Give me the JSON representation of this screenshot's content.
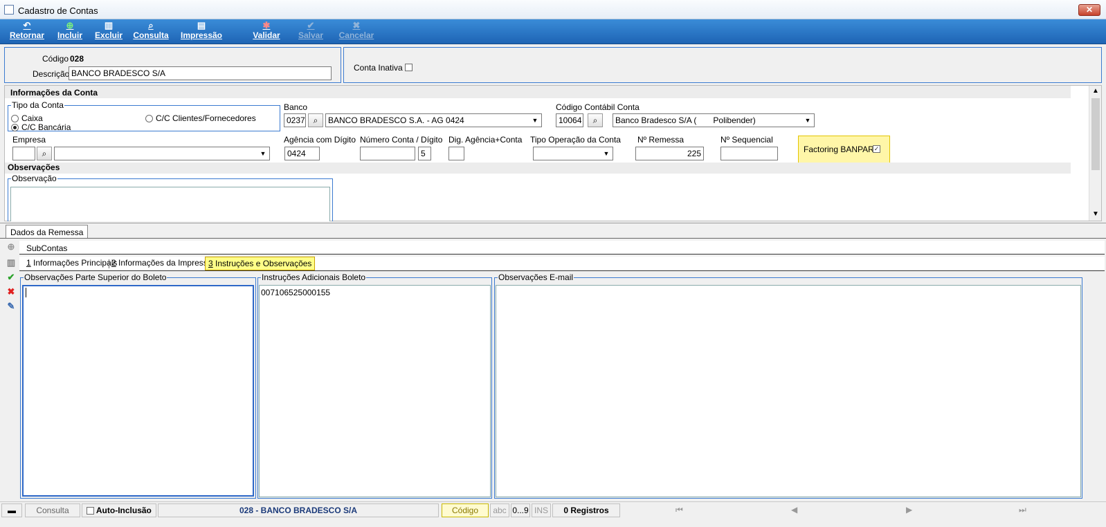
{
  "window": {
    "title": "Cadastro de Contas",
    "close_label": "✕"
  },
  "toolbar": {
    "retornar": "Retornar",
    "incluir": "Incluir",
    "excluir": "Excluir",
    "consulta": "Consulta",
    "impressao": "Impressão",
    "validar": "Validar",
    "salvar": "Salvar",
    "cancelar": "Cancelar"
  },
  "header": {
    "codigo_label": "Código",
    "codigo_value": "028",
    "descricao_label": "Descrição",
    "descricao_value": "BANCO BRADESCO S/A ",
    "conta_inativa_label": "Conta Inativa"
  },
  "info": {
    "section_title": "Informações da Conta",
    "tipo_conta_title": "Tipo da Conta",
    "opt_caixa": "Caixa",
    "opt_cc_bancaria": "C/C Bancária",
    "opt_cc_clientes": "C/C Clientes/Fornecedores",
    "banco_label": "Banco",
    "banco_code": "0237",
    "banco_name": "BANCO BRADESCO S.A. - AG 0424",
    "cod_contabil_label": "Código Contábil Conta",
    "cod_contabil_code": "10064",
    "cod_contabil_name": "Banco Bradesco S/A (",
    "cod_contabil_name_suffix": "Polibender)",
    "empresa_label": "Empresa",
    "empresa_code": "",
    "empresa_name": "",
    "agencia_label": "Agência com Dígito",
    "agencia_value": "0424",
    "numero_conta_label": "Número Conta / Dígito",
    "numero_conta_value": "",
    "numero_conta_digito": "5",
    "dig_agencia_label": "Dig. Agência+Conta",
    "dig_agencia_value": "",
    "tipo_operacao_label": "Tipo Operação da Conta",
    "tipo_operacao_value": "",
    "n_remessa_label": "Nº Remessa",
    "n_remessa_value": "225",
    "n_sequencial_label": "Nº Sequencial",
    "n_sequencial_value": "",
    "factoring_label": "Factoring BANPAR",
    "observacoes_section": "Observações",
    "observacao_title": "Observação"
  },
  "tabs": {
    "dados_remessa": "Dados da Remessa",
    "subcontas": "SubContas",
    "sub1_num": "1",
    "sub1": " Informações Principais",
    "sub2_num": "2",
    "sub2": " Informações da Impressão",
    "sub3_num": "3",
    "sub3": " Instruções e Observações"
  },
  "boleto": {
    "obs_superior_title": "Observações Parte Superior do Boleto",
    "obs_superior_value": "",
    "instrucoes_title": "Instruções Adicionais Boleto",
    "instrucoes_value": "007106525000155",
    "obs_email_title": "Observações E-mail",
    "obs_email_value": ""
  },
  "statusbar": {
    "consulta": "Consulta",
    "auto_inclusao": "Auto-Inclusão",
    "record": "028 - BANCO BRADESCO S/A ",
    "codigo": "Código",
    "abc": "abc",
    "range": "0...9",
    "ins": "INS",
    "registros": "0 Registros",
    "nav_first": "⏮",
    "nav_prev": "◀",
    "nav_next": "▶",
    "nav_last": "⏭"
  },
  "colors": {
    "toolbar": "#1e64b4",
    "highlight": "#ffff88",
    "border_blue": "#3a7ad0"
  },
  "icons": [
    "retornar-icon",
    "incluir-icon",
    "excluir-icon",
    "consulta-icon",
    "impressao-icon",
    "validar-icon",
    "salvar-icon",
    "cancelar-icon",
    "search-icon",
    "add-icon",
    "delete-icon",
    "confirm-icon",
    "cancel-icon",
    "edit-icon"
  ]
}
